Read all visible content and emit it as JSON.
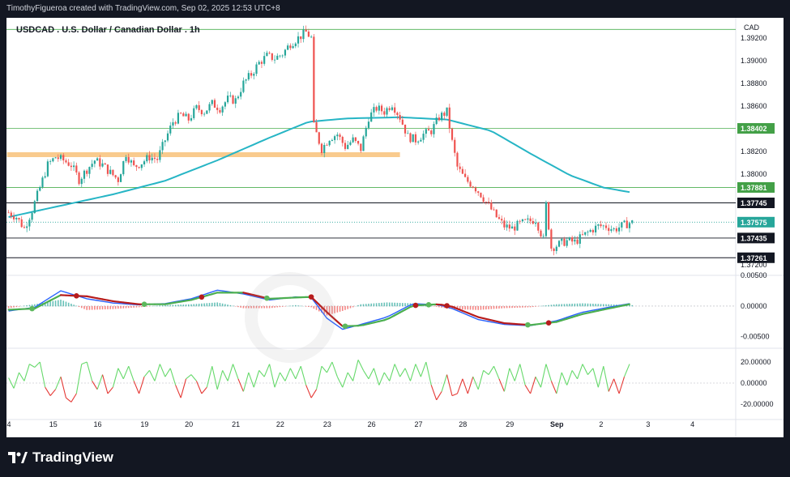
{
  "header": {
    "attribution": "TimothyFigueroa created with TradingView.com, Sep 02, 2025 12:53 UTC+8"
  },
  "footer": {
    "brand": "TradingView",
    "brand_icon": "tradingview-logo-icon"
  },
  "chart_data": {
    "type": "candlestick",
    "title": "USDCAD . U.S. Dollar / Canadian Dollar . 1h",
    "currency_label": "CAD",
    "colors": {
      "up": "#26a69a",
      "down": "#ef5350",
      "ma_line": "#26b5c5",
      "support_zone": "#f8c27a",
      "green_level": "#4caf50",
      "black_level": "#131722",
      "macd_line": "#2962ff",
      "signal_up": "#4caf50",
      "signal_down": "#b71c1c",
      "rsi_up": "#66d96b",
      "rsi_down": "#e53935"
    },
    "price_axis": {
      "range": [
        1.3712,
        1.3932
      ],
      "ticks": [
        "1.39200",
        "1.39000",
        "1.38800",
        "1.38600",
        "1.38200",
        "1.38000",
        "1.37200"
      ]
    },
    "x_axis": {
      "ticks": [
        "4",
        "15",
        "16",
        "19",
        "20",
        "21",
        "22",
        "23",
        "26",
        "27",
        "28",
        "29",
        "Sep",
        "2",
        "3",
        "4"
      ]
    },
    "close_path": [
      [
        0,
        1.3766
      ],
      [
        3,
        1.3762
      ],
      [
        6,
        1.3752
      ],
      [
        9,
        1.3768
      ],
      [
        12,
        1.3788
      ],
      [
        15,
        1.3808
      ],
      [
        18,
        1.3815
      ],
      [
        21,
        1.3812
      ],
      [
        24,
        1.3808
      ],
      [
        27,
        1.3795
      ],
      [
        30,
        1.3804
      ],
      [
        33,
        1.3812
      ],
      [
        36,
        1.3808
      ],
      [
        39,
        1.3801
      ],
      [
        42,
        1.3795
      ],
      [
        45,
        1.3818
      ],
      [
        48,
        1.3806
      ],
      [
        51,
        1.381
      ],
      [
        54,
        1.3815
      ],
      [
        57,
        1.3813
      ],
      [
        60,
        1.383
      ],
      [
        63,
        1.3846
      ],
      [
        66,
        1.3852
      ],
      [
        69,
        1.3848
      ],
      [
        72,
        1.3858
      ],
      [
        75,
        1.3855
      ],
      [
        78,
        1.3862
      ],
      [
        81,
        1.3858
      ],
      [
        84,
        1.3866
      ],
      [
        87,
        1.3865
      ],
      [
        90,
        1.388
      ],
      [
        93,
        1.3888
      ],
      [
        96,
        1.3898
      ],
      [
        99,
        1.3904
      ],
      [
        102,
        1.3902
      ],
      [
        105,
        1.3906
      ],
      [
        108,
        1.3915
      ],
      [
        111,
        1.392
      ],
      [
        114,
        1.3925
      ],
      [
        116,
        1.392
      ],
      [
        117,
        1.3842
      ],
      [
        120,
        1.3822
      ],
      [
        123,
        1.3832
      ],
      [
        126,
        1.3835
      ],
      [
        129,
        1.3824
      ],
      [
        132,
        1.383
      ],
      [
        135,
        1.3822
      ],
      [
        138,
        1.385
      ],
      [
        141,
        1.3858
      ],
      [
        144,
        1.3855
      ],
      [
        147,
        1.3862
      ],
      [
        150,
        1.385
      ],
      [
        153,
        1.3833
      ],
      [
        156,
        1.383
      ],
      [
        159,
        1.3835
      ],
      [
        162,
        1.3838
      ],
      [
        165,
        1.385
      ],
      [
        168,
        1.3855
      ],
      [
        170,
        1.3828
      ],
      [
        172,
        1.3806
      ],
      [
        175,
        1.3795
      ],
      [
        178,
        1.379
      ],
      [
        181,
        1.3782
      ],
      [
        184,
        1.3772
      ],
      [
        187,
        1.3762
      ],
      [
        190,
        1.3754
      ],
      [
        193,
        1.3752
      ],
      [
        196,
        1.3756
      ],
      [
        199,
        1.3758
      ],
      [
        202,
        1.376
      ],
      [
        205,
        1.3742
      ],
      [
        206,
        1.3773
      ],
      [
        208,
        1.3735
      ],
      [
        211,
        1.3738
      ],
      [
        214,
        1.3741
      ],
      [
        217,
        1.374
      ],
      [
        220,
        1.3745
      ],
      [
        223,
        1.375
      ],
      [
        226,
        1.3754
      ],
      [
        229,
        1.3754
      ],
      [
        232,
        1.3751
      ],
      [
        235,
        1.3754
      ],
      [
        238,
        1.3757
      ]
    ],
    "moving_average": [
      [
        0,
        1.3762
      ],
      [
        20,
        1.3772
      ],
      [
        40,
        1.3782
      ],
      [
        60,
        1.3794
      ],
      [
        80,
        1.3812
      ],
      [
        100,
        1.3832
      ],
      [
        115,
        1.3846
      ],
      [
        130,
        1.3849
      ],
      [
        150,
        1.385
      ],
      [
        168,
        1.3848
      ],
      [
        185,
        1.3838
      ],
      [
        200,
        1.3818
      ],
      [
        215,
        1.3799
      ],
      [
        228,
        1.3788
      ],
      [
        238,
        1.3784
      ]
    ],
    "levels": [
      {
        "price": 1.39275,
        "color": "green",
        "label": ""
      },
      {
        "price": 1.38402,
        "color": "green",
        "label": "1.38402"
      },
      {
        "price": 1.37881,
        "color": "green",
        "label": "1.37881"
      },
      {
        "price": 1.37745,
        "color": "black",
        "label": "1.37745"
      },
      {
        "price": 1.37575,
        "color": "dotted-green",
        "label": "1.37575"
      },
      {
        "price": 1.37435,
        "color": "black",
        "label": "1.37435"
      },
      {
        "price": 1.37261,
        "color": "black",
        "label": "1.37261"
      }
    ],
    "support_zone": {
      "price": 1.3817,
      "from_bar": 0,
      "to_bar": 150
    },
    "macd": {
      "ticks": [
        "0.00500",
        "0.00000",
        "-0.00500"
      ],
      "range": [
        -0.0065,
        0.0045
      ],
      "macd_line": [
        [
          0,
          -0.0008
        ],
        [
          10,
          -0.0002
        ],
        [
          20,
          0.0025
        ],
        [
          30,
          0.0012
        ],
        [
          40,
          0.0005
        ],
        [
          50,
          0.0002
        ],
        [
          60,
          0.0004
        ],
        [
          70,
          0.0012
        ],
        [
          80,
          0.0026
        ],
        [
          90,
          0.002
        ],
        [
          100,
          0.001
        ],
        [
          110,
          0.0015
        ],
        [
          116,
          0.0014
        ],
        [
          122,
          -0.002
        ],
        [
          128,
          -0.0038
        ],
        [
          135,
          -0.003
        ],
        [
          145,
          -0.0018
        ],
        [
          155,
          0.0004
        ],
        [
          165,
          0.0002
        ],
        [
          170,
          -0.0004
        ],
        [
          180,
          -0.0022
        ],
        [
          190,
          -0.003
        ],
        [
          200,
          -0.0032
        ],
        [
          210,
          -0.0024
        ],
        [
          220,
          -0.001
        ],
        [
          230,
          -0.0002
        ],
        [
          238,
          0.0004
        ]
      ],
      "signal_line": [
        [
          0,
          -0.0006
        ],
        [
          10,
          -0.0004
        ],
        [
          20,
          0.0018
        ],
        [
          30,
          0.0016
        ],
        [
          40,
          0.0008
        ],
        [
          50,
          0.0003
        ],
        [
          60,
          0.0003
        ],
        [
          70,
          0.001
        ],
        [
          80,
          0.0022
        ],
        [
          90,
          0.0022
        ],
        [
          100,
          0.0012
        ],
        [
          110,
          0.0014
        ],
        [
          116,
          0.0015
        ],
        [
          122,
          -0.001
        ],
        [
          128,
          -0.0033
        ],
        [
          135,
          -0.0032
        ],
        [
          145,
          -0.0022
        ],
        [
          155,
          0.0001
        ],
        [
          165,
          0.0003
        ],
        [
          170,
          -0.0001
        ],
        [
          180,
          -0.0018
        ],
        [
          190,
          -0.0028
        ],
        [
          200,
          -0.0031
        ],
        [
          210,
          -0.0026
        ],
        [
          220,
          -0.0013
        ],
        [
          230,
          -0.0004
        ],
        [
          238,
          0.0003
        ]
      ],
      "cross_points": [
        [
          9,
          "up"
        ],
        [
          26,
          "down"
        ],
        [
          52,
          "up"
        ],
        [
          74,
          "down"
        ],
        [
          99,
          "up"
        ],
        [
          116,
          "down"
        ],
        [
          129,
          "up"
        ],
        [
          156,
          "down"
        ],
        [
          161,
          "up"
        ],
        [
          168,
          "down"
        ],
        [
          199,
          "up"
        ],
        [
          207,
          "down"
        ]
      ]
    },
    "rsi": {
      "ticks": [
        "20.00000",
        "0.00000",
        "-20.00000"
      ],
      "range": [
        -30,
        30
      ],
      "values": [
        [
          0,
          5
        ],
        [
          2,
          -5
        ],
        [
          4,
          10
        ],
        [
          6,
          2
        ],
        [
          8,
          18
        ],
        [
          10,
          15
        ],
        [
          12,
          20
        ],
        [
          14,
          -4
        ],
        [
          16,
          -12
        ],
        [
          18,
          -6
        ],
        [
          20,
          6
        ],
        [
          22,
          -14
        ],
        [
          24,
          -18
        ],
        [
          26,
          -10
        ],
        [
          28,
          18
        ],
        [
          30,
          20
        ],
        [
          32,
          2
        ],
        [
          34,
          -6
        ],
        [
          36,
          8
        ],
        [
          38,
          -10
        ],
        [
          40,
          -4
        ],
        [
          42,
          14
        ],
        [
          44,
          4
        ],
        [
          46,
          16
        ],
        [
          48,
          2
        ],
        [
          50,
          -10
        ],
        [
          52,
          6
        ],
        [
          54,
          12
        ],
        [
          56,
          2
        ],
        [
          58,
          18
        ],
        [
          60,
          6
        ],
        [
          62,
          14
        ],
        [
          64,
          -2
        ],
        [
          66,
          -14
        ],
        [
          68,
          4
        ],
        [
          70,
          8
        ],
        [
          72,
          2
        ],
        [
          74,
          -10
        ],
        [
          76,
          -4
        ],
        [
          78,
          16
        ],
        [
          80,
          -6
        ],
        [
          82,
          12
        ],
        [
          84,
          2
        ],
        [
          86,
          18
        ],
        [
          88,
          4
        ],
        [
          90,
          -8
        ],
        [
          92,
          10
        ],
        [
          94,
          -4
        ],
        [
          96,
          12
        ],
        [
          98,
          6
        ],
        [
          100,
          18
        ],
        [
          102,
          -4
        ],
        [
          104,
          10
        ],
        [
          106,
          2
        ],
        [
          108,
          14
        ],
        [
          110,
          4
        ],
        [
          112,
          16
        ],
        [
          114,
          -2
        ],
        [
          116,
          -14
        ],
        [
          118,
          -6
        ],
        [
          120,
          16
        ],
        [
          122,
          10
        ],
        [
          124,
          20
        ],
        [
          126,
          6
        ],
        [
          128,
          -4
        ],
        [
          130,
          10
        ],
        [
          132,
          2
        ],
        [
          134,
          22
        ],
        [
          136,
          12
        ],
        [
          138,
          4
        ],
        [
          140,
          14
        ],
        [
          142,
          -2
        ],
        [
          144,
          10
        ],
        [
          146,
          2
        ],
        [
          148,
          18
        ],
        [
          150,
          6
        ],
        [
          152,
          14
        ],
        [
          154,
          2
        ],
        [
          156,
          18
        ],
        [
          158,
          6
        ],
        [
          160,
          20
        ],
        [
          162,
          -2
        ],
        [
          164,
          -16
        ],
        [
          166,
          -8
        ],
        [
          168,
          8
        ],
        [
          170,
          -12
        ],
        [
          172,
          -10
        ],
        [
          174,
          4
        ],
        [
          176,
          -10
        ],
        [
          178,
          6
        ],
        [
          180,
          -6
        ],
        [
          182,
          12
        ],
        [
          184,
          8
        ],
        [
          186,
          16
        ],
        [
          188,
          4
        ],
        [
          190,
          -8
        ],
        [
          192,
          14
        ],
        [
          194,
          2
        ],
        [
          196,
          18
        ],
        [
          198,
          -2
        ],
        [
          200,
          -10
        ],
        [
          202,
          6
        ],
        [
          204,
          -4
        ],
        [
          206,
          18
        ],
        [
          208,
          2
        ],
        [
          210,
          -10
        ],
        [
          212,
          10
        ],
        [
          214,
          -2
        ],
        [
          216,
          12
        ],
        [
          218,
          4
        ],
        [
          220,
          18
        ],
        [
          222,
          8
        ],
        [
          224,
          14
        ],
        [
          226,
          -4
        ],
        [
          228,
          16
        ],
        [
          230,
          -8
        ],
        [
          232,
          4
        ],
        [
          234,
          -10
        ],
        [
          236,
          6
        ],
        [
          238,
          18
        ]
      ]
    }
  }
}
